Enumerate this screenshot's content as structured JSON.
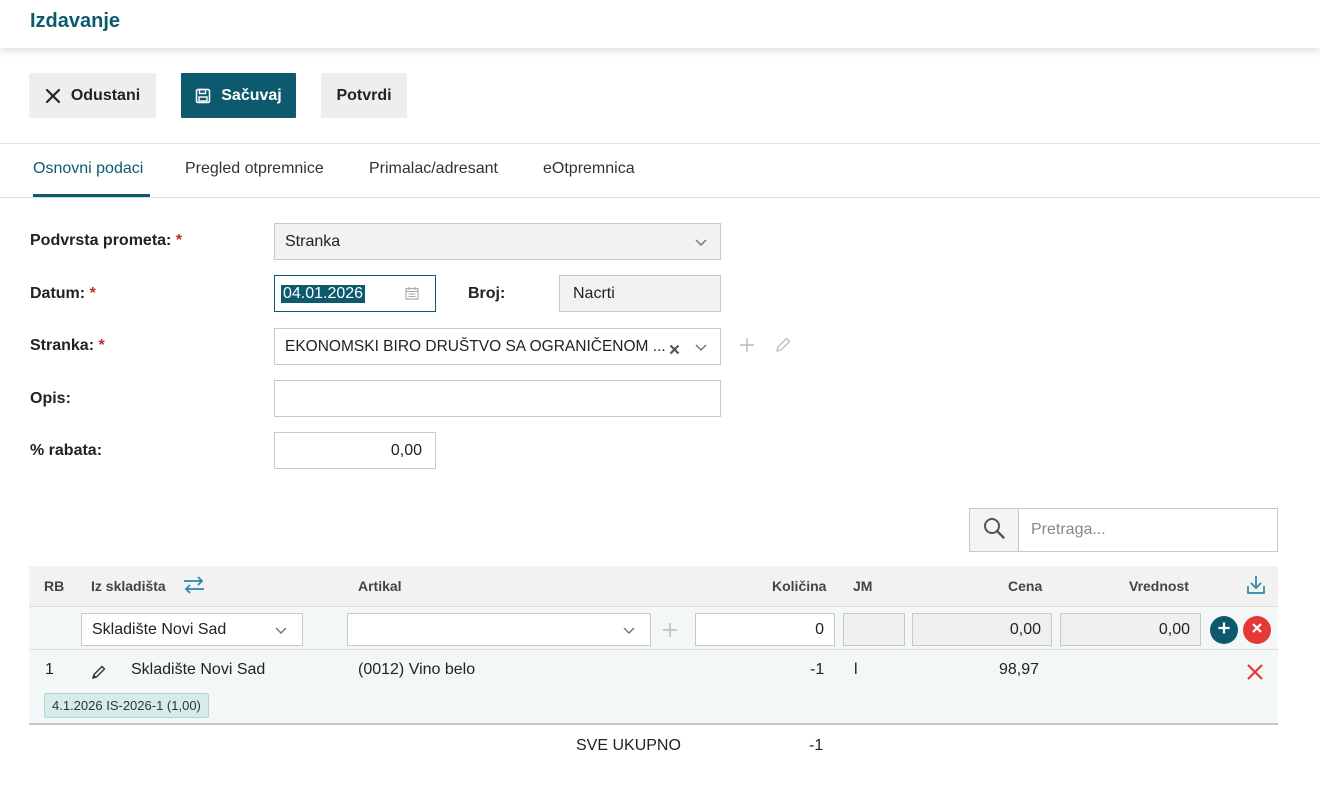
{
  "header": {
    "title": "Izdavanje"
  },
  "toolbar": {
    "cancel_label": "Odustani",
    "save_label": "Sačuvaj",
    "confirm_label": "Potvrdi"
  },
  "tabs": [
    {
      "label": "Osnovni podaci",
      "active": true
    },
    {
      "label": "Pregled otpremnice",
      "active": false
    },
    {
      "label": "Primalac/adresant",
      "active": false
    },
    {
      "label": "eOtpremnica",
      "active": false
    }
  ],
  "form": {
    "subtype_label": "Podvrsta prometa:",
    "subtype_value": "Stranka",
    "date_label": "Datum:",
    "date_value": "04.01.2026",
    "number_label": "Broj:",
    "number_value": "Nacrti",
    "party_label": "Stranka:",
    "party_value": "EKONOMSKI BIRO DRUŠTVO SA OGRANIČENOM ...",
    "desc_label": "Opis:",
    "desc_value": "",
    "discount_label": "% rabata:",
    "discount_value": "0,00",
    "required_mark": "*"
  },
  "search": {
    "placeholder": "Pretraga..."
  },
  "grid": {
    "headers": {
      "rb": "RB",
      "warehouse": "Iz skladišta",
      "item": "Artikal",
      "qty": "Količina",
      "unit": "JM",
      "price": "Cena",
      "value": "Vrednost"
    },
    "edit_row": {
      "warehouse": "Skladište Novi Sad",
      "item": "",
      "qty": "0",
      "unit": "",
      "price": "0,00",
      "value": "0,00"
    },
    "rows": [
      {
        "rb": "1",
        "warehouse": "Skladište Novi Sad",
        "item": "(0012) Vino belo",
        "qty": "-1",
        "unit": "l",
        "price": "98,97",
        "value": "",
        "tag": "4.1.2026 IS-2026-1 (1,00)"
      }
    ],
    "total_label": "SVE UKUPNO",
    "total_qty": "-1"
  },
  "colors": {
    "primary": "#0d5a6e",
    "danger": "#e53935",
    "required": "#c62828"
  }
}
